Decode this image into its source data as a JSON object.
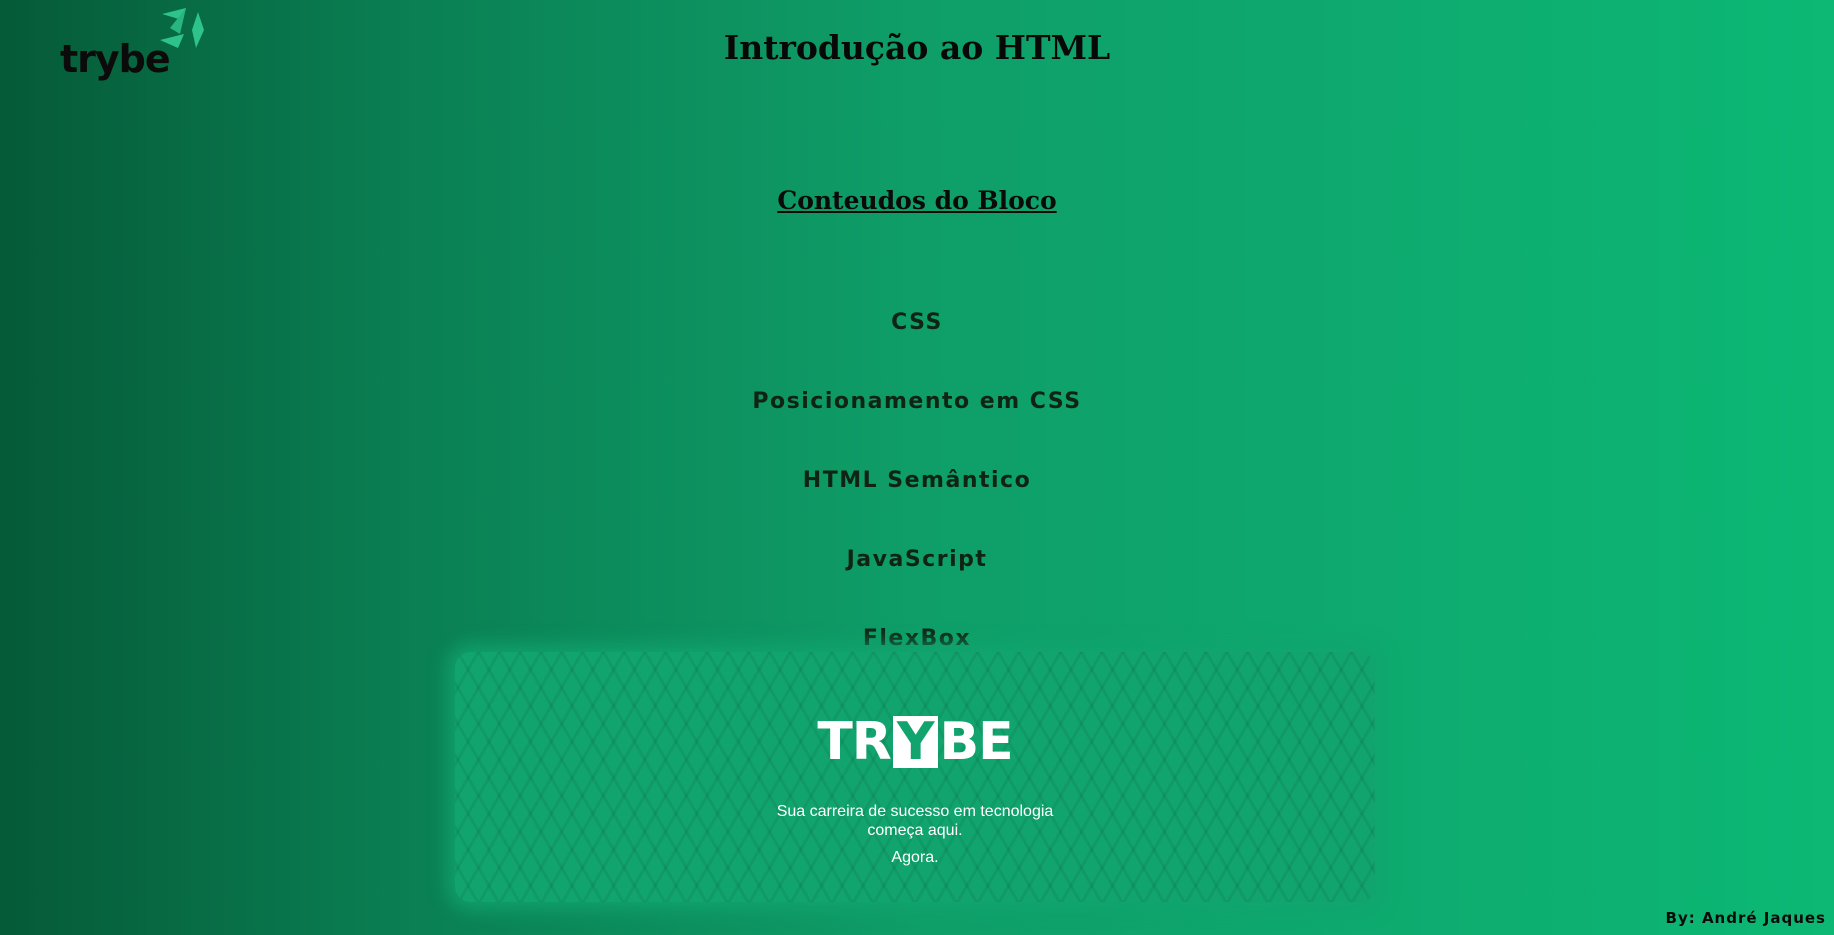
{
  "logo": {
    "wordmark": "trybe",
    "icon": "trybe-plane-icon"
  },
  "page_title": "Introdução ao HTML",
  "section_title": "Conteudos do Bloco",
  "topics": [
    {
      "label": "CSS"
    },
    {
      "label": "Posicionamento em CSS"
    },
    {
      "label": "HTML Semântico"
    },
    {
      "label": "JavaScript"
    },
    {
      "label": "FlexBox"
    }
  ],
  "banner": {
    "logo_pre": "TR",
    "logo_y": "Y",
    "logo_post": "BE",
    "tagline": "Sua carreira de sucesso em tecnologia começa aqui.",
    "sub": "Agora."
  },
  "credit": "By: André Jaques",
  "colors": {
    "gradient_start": "#055a37",
    "gradient_end": "#0cb874",
    "logo_mark": "#2ec38a",
    "banner_bg": "#12a46e"
  }
}
